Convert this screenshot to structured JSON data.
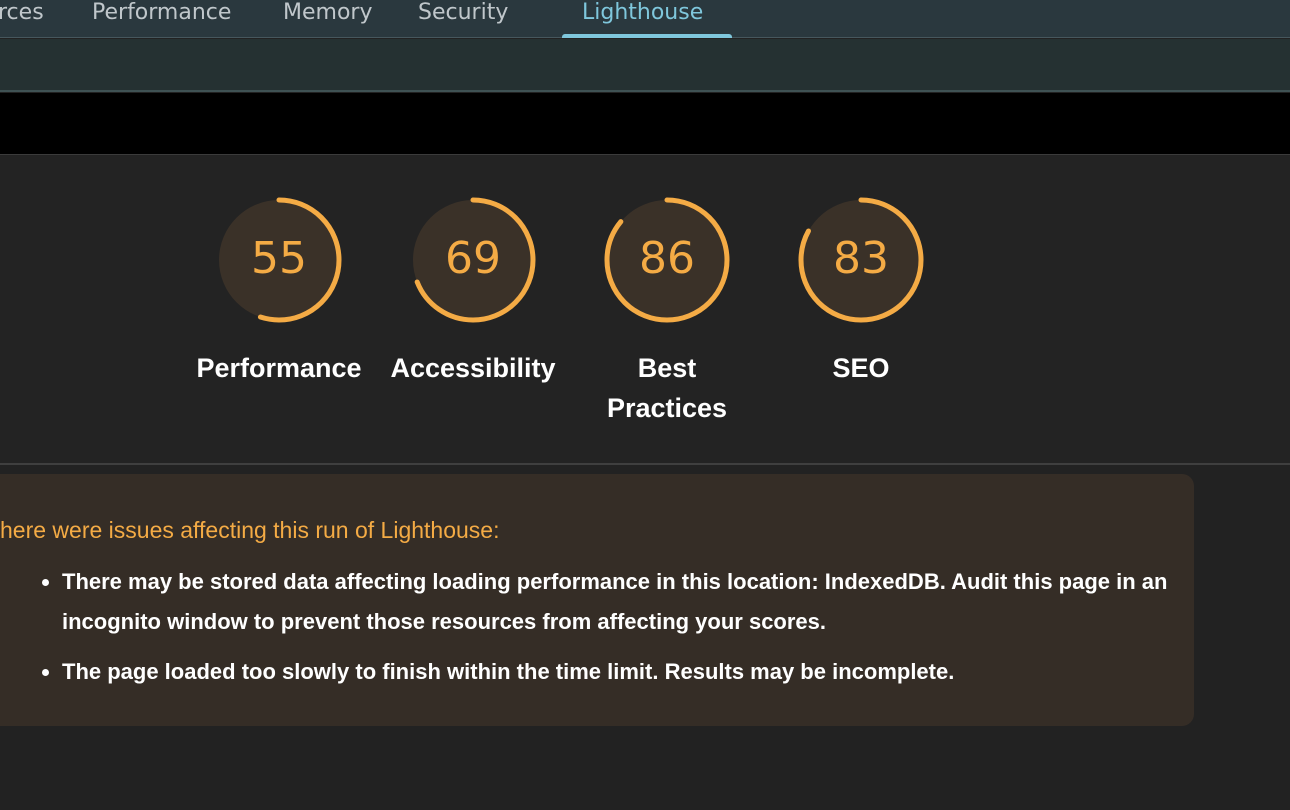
{
  "tabs": [
    {
      "label": "rces",
      "active": false
    },
    {
      "label": "Performance",
      "active": false
    },
    {
      "label": "Memory",
      "active": false
    },
    {
      "label": "Security",
      "active": false
    },
    {
      "label": "Lighthouse",
      "active": true
    }
  ],
  "gauges": [
    {
      "score": "55",
      "value": 55,
      "label": "Performance"
    },
    {
      "score": "69",
      "value": 69,
      "label": "Accessibility"
    },
    {
      "score": "86",
      "value": 86,
      "label_line1": "Best",
      "label_line2": "Practices"
    },
    {
      "score": "83",
      "value": 83,
      "label": "SEO"
    }
  ],
  "colors": {
    "score_average": "#f4ab45",
    "gauge_fill": "#3a3128",
    "active_tab": "#7fc7dc"
  },
  "warnings": {
    "title": "here were issues affecting this run of Lighthouse:",
    "items": [
      "There may be stored data affecting loading performance in this location: IndexedDB. Audit this page in an incognito window to prevent those resources from affecting your scores.",
      "The page loaded too slowly to finish within the time limit. Results may be incomplete."
    ]
  }
}
